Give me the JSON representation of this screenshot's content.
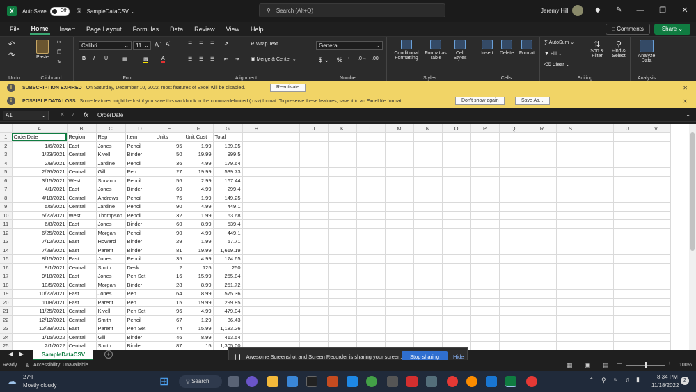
{
  "titlebar": {
    "app_logo": "X",
    "autosave_label": "AutoSave",
    "autosave_state": "Off",
    "filename": "SampleDataCSV",
    "search_placeholder": "Search (Alt+Q)",
    "user_name": "Jeremy Hill"
  },
  "menu": [
    "File",
    "Home",
    "Insert",
    "Page Layout",
    "Formulas",
    "Data",
    "Review",
    "View",
    "Help"
  ],
  "active_menu": "Home",
  "header_buttons": {
    "comments": "Comments",
    "share": "Share"
  },
  "ribbon": {
    "undo_label": "Undo",
    "clipboard_label": "Clipboard",
    "paste_label": "Paste",
    "font_label": "Font",
    "font_name": "Calibri",
    "font_size": "11",
    "alignment_label": "Alignment",
    "wrap_text": "Wrap Text",
    "merge_center": "Merge & Center",
    "number_label": "Number",
    "number_format": "General",
    "styles_label": "Styles",
    "conditional_formatting": "Conditional Formatting",
    "format_as_table": "Format as Table",
    "cell_styles": "Cell Styles",
    "cells_label": "Cells",
    "insert": "Insert",
    "delete": "Delete",
    "format": "Format",
    "editing_label": "Editing",
    "autosum": "AutoSum",
    "fill": "Fill",
    "clear": "Clear",
    "sort_filter": "Sort & Filter",
    "find_select": "Find & Select",
    "analysis_label": "Analysis",
    "analyze_data": "Analyze Data"
  },
  "messages": {
    "sub_title": "SUBSCRIPTION EXPIRED",
    "sub_text": "On Saturday, December 10, 2022, most features of Excel will be disabled.",
    "sub_button": "Reactivate",
    "loss_title": "POSSIBLE DATA LOSS",
    "loss_text": "Some features might be lost if you save this workbook in the comma-delimited (.csv) format. To preserve these features, save it in an Excel file format.",
    "loss_button1": "Don't show again",
    "loss_button2": "Save As..."
  },
  "formula_bar": {
    "name_box": "A1",
    "fx": "fx",
    "formula": "OrderDate"
  },
  "columns": [
    "A",
    "B",
    "C",
    "D",
    "E",
    "F",
    "G",
    "H",
    "I",
    "J",
    "K",
    "L",
    "M",
    "N",
    "O",
    "P",
    "Q",
    "R",
    "S",
    "T",
    "U",
    "V"
  ],
  "rows": [
    [
      "OrderDate",
      "Region",
      "Rep",
      "Item",
      "Units",
      "Unit Cost",
      "Total"
    ],
    [
      "1/6/2021",
      "East",
      "Jones",
      "Pencil",
      "95",
      "1.99",
      "189.05"
    ],
    [
      "1/23/2021",
      "Central",
      "Kivell",
      "Binder",
      "50",
      "19.99",
      "999.5"
    ],
    [
      "2/9/2021",
      "Central",
      "Jardine",
      "Pencil",
      "36",
      "4.99",
      "179.64"
    ],
    [
      "2/26/2021",
      "Central",
      "Gill",
      "Pen",
      "27",
      "19.99",
      "539.73"
    ],
    [
      "3/15/2021",
      "West",
      "Sorvino",
      "Pencil",
      "56",
      "2.99",
      "167.44"
    ],
    [
      "4/1/2021",
      "East",
      "Jones",
      "Binder",
      "60",
      "4.99",
      "299.4"
    ],
    [
      "4/18/2021",
      "Central",
      "Andrews",
      "Pencil",
      "75",
      "1.99",
      "149.25"
    ],
    [
      "5/5/2021",
      "Central",
      "Jardine",
      "Pencil",
      "90",
      "4.99",
      "449.1"
    ],
    [
      "5/22/2021",
      "West",
      "Thompson",
      "Pencil",
      "32",
      "1.99",
      "63.68"
    ],
    [
      "6/8/2021",
      "East",
      "Jones",
      "Binder",
      "60",
      "8.99",
      "539.4"
    ],
    [
      "6/25/2021",
      "Central",
      "Morgan",
      "Pencil",
      "90",
      "4.99",
      "449.1"
    ],
    [
      "7/12/2021",
      "East",
      "Howard",
      "Binder",
      "29",
      "1.99",
      "57.71"
    ],
    [
      "7/29/2021",
      "East",
      "Parent",
      "Binder",
      "81",
      "19.99",
      "1,619.19"
    ],
    [
      "8/15/2021",
      "East",
      "Jones",
      "Pencil",
      "35",
      "4.99",
      "174.65"
    ],
    [
      "9/1/2021",
      "Central",
      "Smith",
      "Desk",
      "2",
      "125",
      "250"
    ],
    [
      "9/18/2021",
      "East",
      "Jones",
      "Pen Set",
      "16",
      "15.99",
      "255.84"
    ],
    [
      "10/5/2021",
      "Central",
      "Morgan",
      "Binder",
      "28",
      "8.99",
      "251.72"
    ],
    [
      "10/22/2021",
      "East",
      "Jones",
      "Pen",
      "64",
      "8.99",
      "575.36"
    ],
    [
      "11/8/2021",
      "East",
      "Parent",
      "Pen",
      "15",
      "19.99",
      "299.85"
    ],
    [
      "11/25/2021",
      "Central",
      "Kivell",
      "Pen Set",
      "96",
      "4.99",
      "479.04"
    ],
    [
      "12/12/2021",
      "Central",
      "Smith",
      "Pencil",
      "67",
      "1.29",
      "86.43"
    ],
    [
      "12/29/2021",
      "East",
      "Parent",
      "Pen Set",
      "74",
      "15.99",
      "1,183.26"
    ],
    [
      "1/15/2022",
      "Central",
      "Gill",
      "Binder",
      "46",
      "8.99",
      "413.54"
    ],
    [
      "2/1/2022",
      "Central",
      "Smith",
      "Binder",
      "87",
      "15",
      "1,305.00"
    ]
  ],
  "sheet_tab": "SampleDataCSV",
  "share_banner": {
    "text": "Awesome Screenshot and Screen Recorder is sharing your screen.",
    "stop": "Stop sharing",
    "hide": "Hide"
  },
  "status": {
    "ready": "Ready",
    "accessibility": "Accessibility: Unavailable",
    "zoom": "100%"
  },
  "taskbar": {
    "temp": "27°F",
    "weather": "Mostly cloudy",
    "search": "Search",
    "time": "8:34 PM",
    "date": "11/18/2022"
  },
  "colors": {
    "excel_green": "#107c41",
    "message_bar": "#f1d466",
    "stop_button": "#2f6fd0"
  }
}
